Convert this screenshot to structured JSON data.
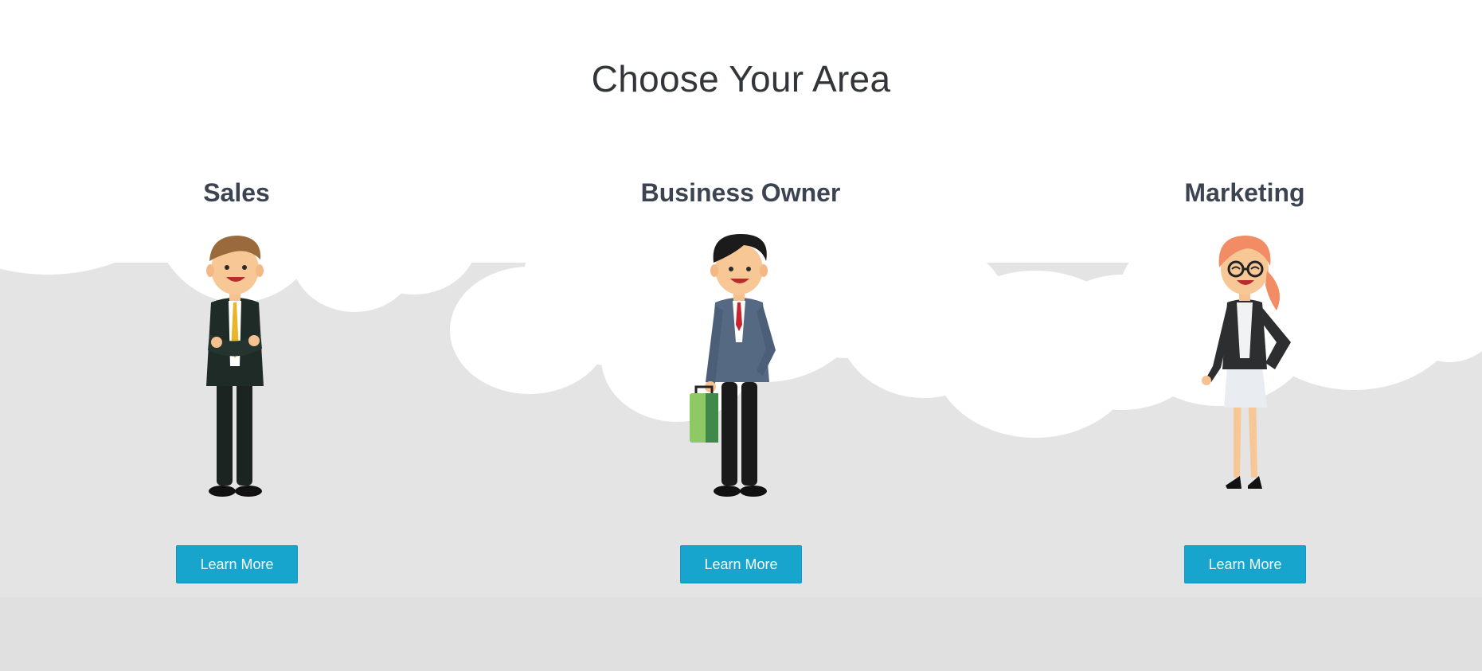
{
  "page": {
    "title": "Choose Your Area"
  },
  "areas": [
    {
      "title": "Sales",
      "button_label": "Learn More",
      "illustration": "salesman-illustration"
    },
    {
      "title": "Business Owner",
      "button_label": "Learn More",
      "illustration": "business-owner-illustration"
    },
    {
      "title": "Marketing",
      "button_label": "Learn More",
      "illustration": "marketer-illustration"
    }
  ],
  "colors": {
    "background_top": "#ffffff",
    "background_bottom": "#e4e4e4",
    "button": "#17a4cd",
    "heading": "#333538",
    "subheading": "#3d4451"
  }
}
